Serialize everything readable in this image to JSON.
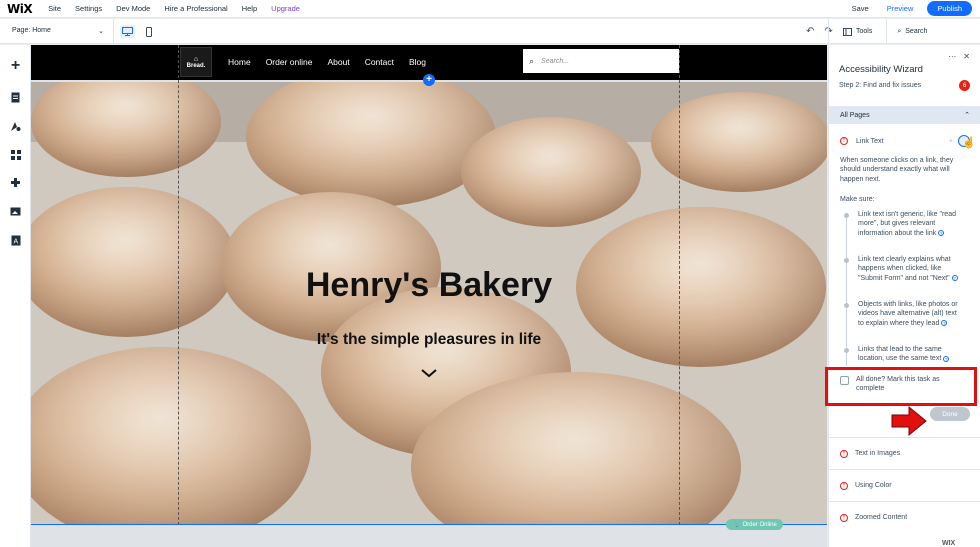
{
  "topbar": {
    "logo": "WiX",
    "menu": [
      "Site",
      "Settings",
      "Dev Mode",
      "Hire a Professional",
      "Help",
      "Upgrade"
    ],
    "save": "Save",
    "preview": "Preview",
    "publish": "Publish"
  },
  "toolbar": {
    "page_label": "Page: Home",
    "tools": "Tools",
    "search": "Search"
  },
  "site": {
    "logo_text": "Bread.",
    "nav": [
      "Home",
      "Order online",
      "About",
      "Contact",
      "Blog"
    ],
    "search_placeholder": "Search...",
    "hero_title": "Henry's Bakery",
    "hero_subtitle": "It's the simple pleasures in life",
    "order_pill": "Order Online"
  },
  "panel": {
    "title": "Accessibility Wizard",
    "step": "Step 2: Find and fix issues",
    "badge_count": "6",
    "section": "All Pages",
    "issue_title": "Link Text",
    "description": "When someone clicks on a link, they should understand exactly what will happen next.",
    "make_sure": "Make sure:",
    "bullets": [
      "Link text isn't generic, like \"read more\", but gives relevant information about the link",
      "Link text clearly explains what happens when clicked, like \"Submit Form\" and not \"Next\"",
      "Objects with links, like photos or videos have alternative (alt) text to explain where they lead",
      "Links that lead to the same location, use the same text"
    ],
    "checkbox_label": "All done? Mark this task as complete",
    "done_label": "Done",
    "other_issues": [
      "Text in Images",
      "Using Color",
      "Zoomed Content"
    ]
  },
  "footer_badge": "WIX",
  "colors": {
    "accent": "#116dff",
    "warning": "#e62214",
    "highlight_box": "#e01010",
    "order_pill": "#6fc7b3"
  }
}
